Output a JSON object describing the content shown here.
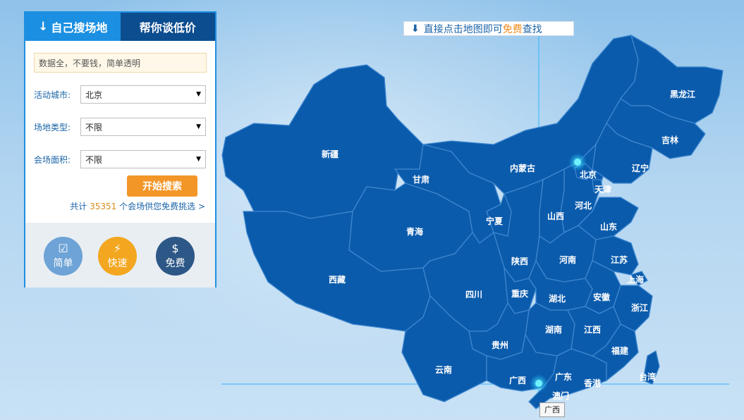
{
  "panel": {
    "tabs": [
      {
        "label": "自己搜场地",
        "active": true
      },
      {
        "label": "帮你谈低价",
        "active": false
      }
    ],
    "hint": "数据全，不要钱，简单透明",
    "fields": [
      {
        "label": "活动城市:",
        "value": "北京"
      },
      {
        "label": "场地类型:",
        "value": "不限"
      },
      {
        "label": "会场面积:",
        "value": "不限"
      }
    ],
    "search_label": "开始搜索",
    "count": {
      "prefix": "共计",
      "number": "35351",
      "suffix": "个会场供您免费挑选 >"
    },
    "features": [
      {
        "label": "简单",
        "icon": "checklist-icon"
      },
      {
        "label": "快速",
        "icon": "lightning-icon"
      },
      {
        "label": "免费",
        "icon": "money-bag-icon"
      }
    ]
  },
  "tip": {
    "before": "直接点击地图即可",
    "highlight": "免费",
    "after": "查找",
    "icon": "down-arrow-icon"
  },
  "map": {
    "provinces": [
      "新疆",
      "西藏",
      "青海",
      "甘肃",
      "内蒙古",
      "黑龙江",
      "吉林",
      "辽宁",
      "北京",
      "天津",
      "河北",
      "山西",
      "宁夏",
      "山东",
      "陕西",
      "河南",
      "江苏",
      "上海",
      "四川",
      "重庆",
      "湖北",
      "安徽",
      "浙江",
      "湖南",
      "江西",
      "贵州",
      "云南",
      "广西",
      "广东",
      "福建",
      "台湾",
      "香港",
      "澳门"
    ],
    "markers": [
      "北京",
      "广西"
    ],
    "tooltip": "广西"
  },
  "colors": {
    "map_fill": "#0b5bac",
    "accent": "#1b8fe2",
    "button": "#f39628"
  }
}
